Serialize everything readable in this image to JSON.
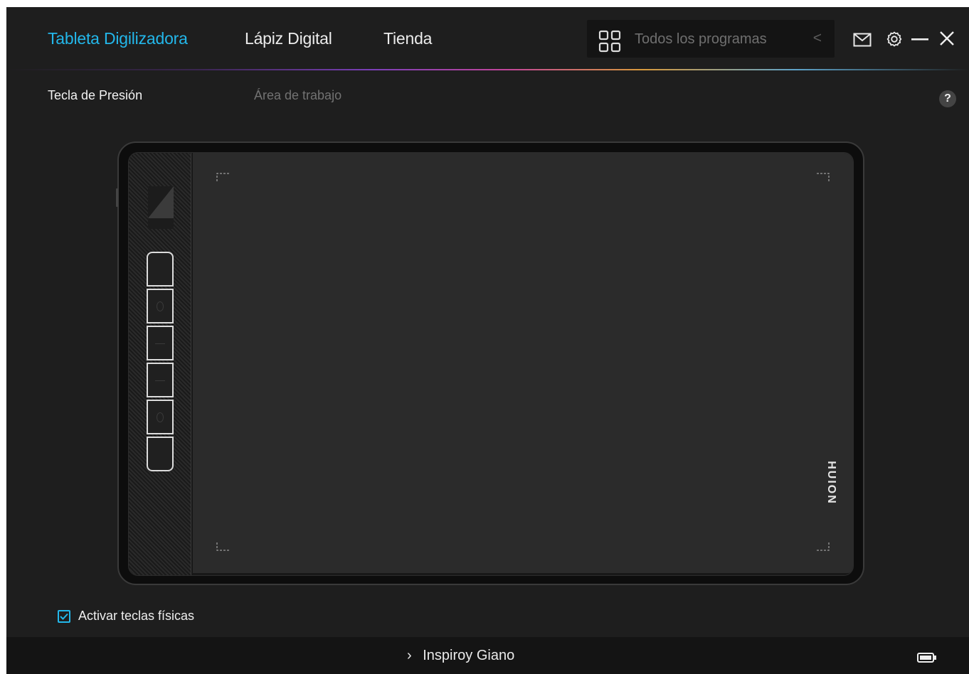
{
  "nav": {
    "tabs": [
      {
        "label": "Tableta Digilizadora",
        "active": true
      },
      {
        "label": "Lápiz Digital",
        "active": false
      },
      {
        "label": "Tienda",
        "active": false
      }
    ],
    "program_selector": {
      "label": "Todos los programas",
      "icon": "apps-grid-icon"
    }
  },
  "window_controls": [
    "mail-icon",
    "settings-icon",
    "minimize-icon",
    "close-icon"
  ],
  "subtabs": [
    {
      "label": "Tecla de Presión",
      "active": true
    },
    {
      "label": "Área de trabajo",
      "active": false
    }
  ],
  "help": {
    "label": "?"
  },
  "tablet": {
    "brand": "HUION",
    "side_buttons": 6
  },
  "checkbox": {
    "label": "Activar teclas físicas",
    "checked": true
  },
  "footer": {
    "device": "Inspiroy Giano",
    "chevron": "›"
  },
  "colors": {
    "accent": "#23b7ea",
    "background": "#1e1e1e"
  }
}
